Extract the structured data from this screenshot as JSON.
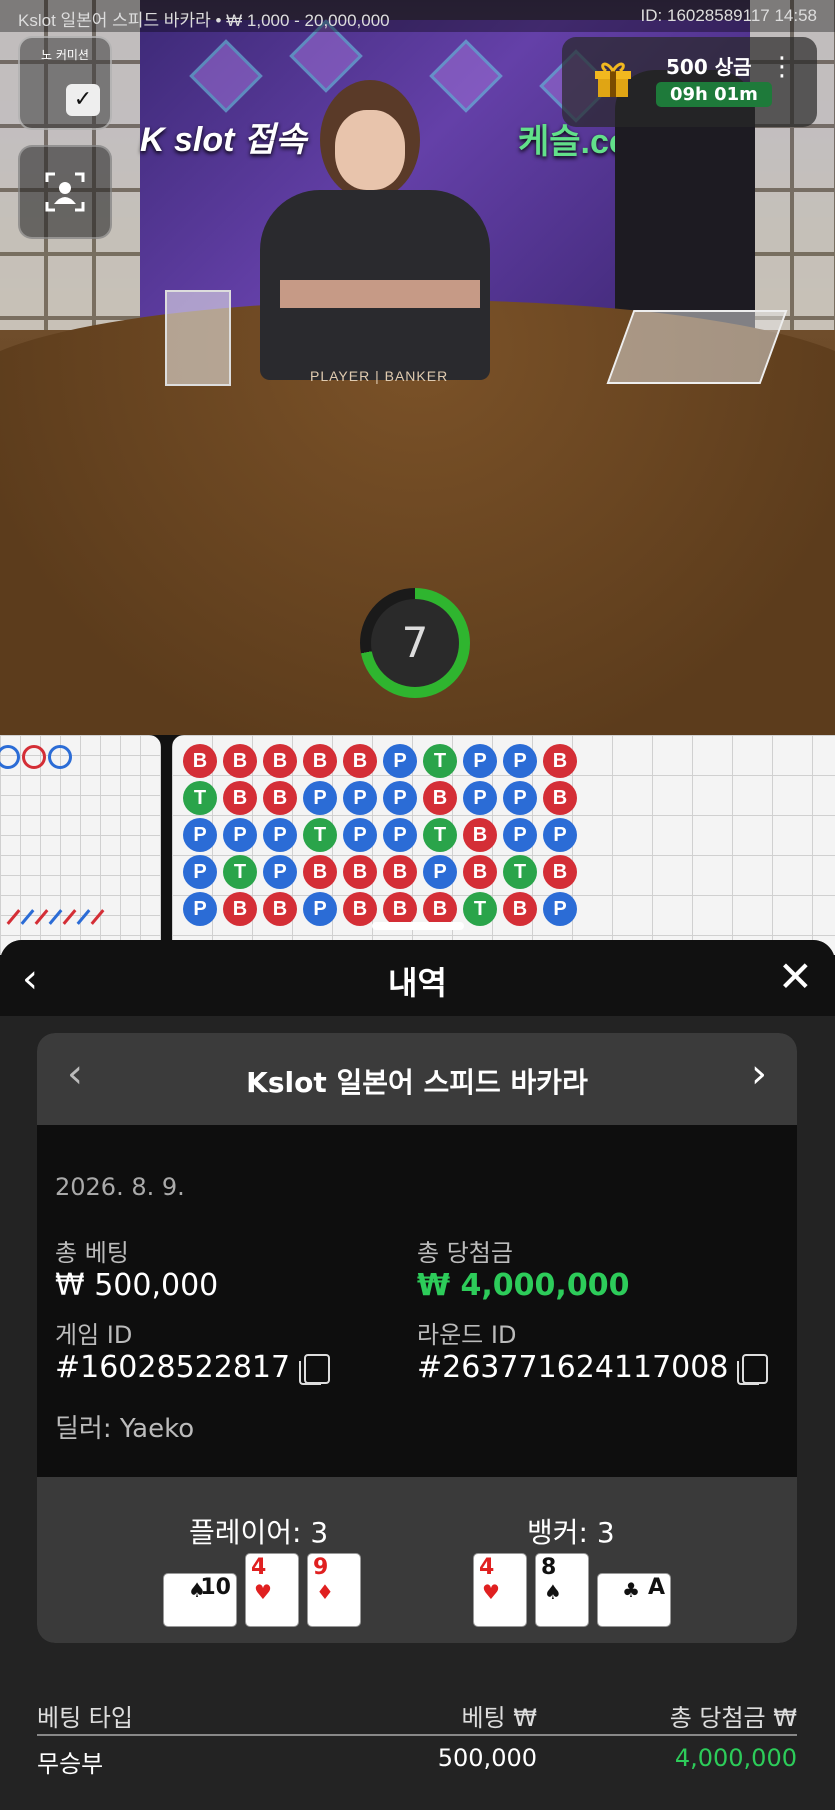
{
  "video": {
    "title": "Kslot 일본어 스피드 바카라 • ₩ 1,000 - 20,000,000",
    "meta": "ID: 16028589117 14:58",
    "brand_left": "K slot 접속",
    "brand_right": "케슬.co",
    "table_text": "PLAYER | BANKER",
    "commission_label": "노 커미션",
    "commission_checked": "✓",
    "rewards_amount": "500 상금",
    "rewards_timer": "09h 01m",
    "countdown": "7",
    "colors": {
      "timer_ring": "#2fb52f",
      "banker": "#d42e36",
      "player": "#2b6cd6",
      "tie": "#2aa44a"
    }
  },
  "roadmap": {
    "rows": [
      [
        "B",
        "B",
        "B",
        "B",
        "B",
        "P",
        "T",
        "P",
        "P",
        "B"
      ],
      [
        "T",
        "B",
        "B",
        "P",
        "P",
        "P",
        "B",
        "P",
        "P",
        "B"
      ],
      [
        "P",
        "P",
        "P",
        "T",
        "P",
        "P",
        "T",
        "B",
        "P",
        "P"
      ],
      [
        "P",
        "T",
        "P",
        "B",
        "B",
        "B",
        "P",
        "B",
        "T",
        "B"
      ],
      [
        "P",
        "B",
        "B",
        "P",
        "B",
        "B",
        "B",
        "T",
        "B",
        "P"
      ]
    ]
  },
  "sheet": {
    "title": "내역",
    "back_icon": "chevron-left-icon",
    "close_icon": "close-icon",
    "game_name": "Kslot 일본어 스피드 바카라",
    "date": "2026. 8. 9.",
    "total_bet_label": "총 베팅",
    "total_bet_value": "₩ 500,000",
    "total_win_label": "총 당첨금",
    "total_win_value": "₩ 4,000,000",
    "game_id_label": "게임 ID",
    "game_id_value": "#16028522817",
    "round_id_label": "라운드 ID",
    "round_id_value": "#263771624117008",
    "dealer": "딜러: Yaeko",
    "player_label": "플레이어: 3",
    "banker_label": "뱅커: 3",
    "player_cards": [
      {
        "rank": "10",
        "suit": "♠"
      },
      {
        "rank": "4",
        "suit": "♥"
      },
      {
        "rank": "9",
        "suit": "♦"
      }
    ],
    "banker_cards": [
      {
        "rank": "4",
        "suit": "♥"
      },
      {
        "rank": "8",
        "suit": "♠"
      },
      {
        "rank": "A",
        "suit": "♣"
      }
    ],
    "table": {
      "headers": [
        "베팅 타입",
        "베팅 ₩",
        "총 당첨금 ₩"
      ],
      "rows": [
        {
          "type": "무승부",
          "bet": "500,000",
          "win": "4,000,000"
        }
      ]
    }
  }
}
